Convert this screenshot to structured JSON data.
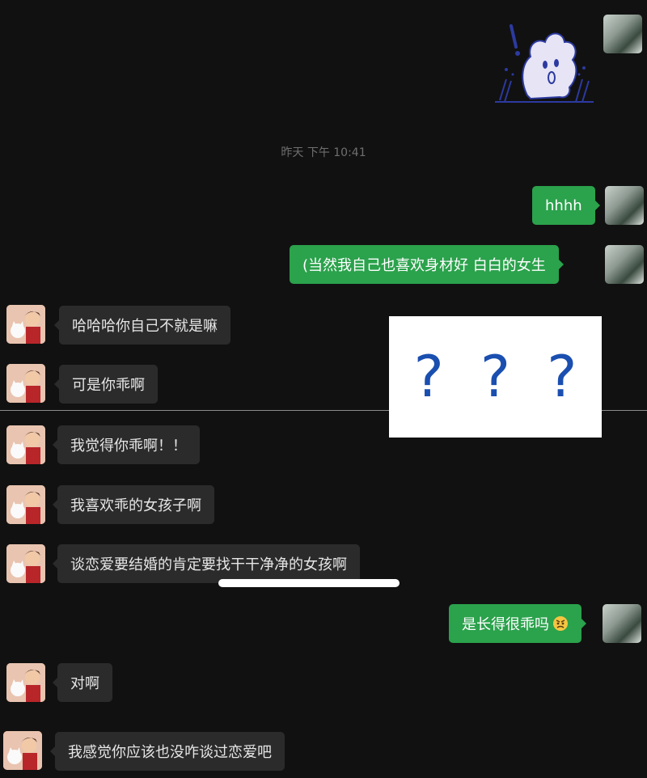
{
  "timestamp": "昨天 下午 10:41",
  "messages": {
    "m1": "hhhh",
    "m2": "(当然我自己也喜欢身材好 白白的女生",
    "m3": "哈哈哈你自己不就是嘛",
    "m4": "可是你乖啊",
    "m5": "我觉得你乖啊！！",
    "m6": "我喜欢乖的女孩子啊",
    "m7": "谈恋爱要结婚的肯定要找干干净净的女孩啊",
    "m8": "是长得很乖吗",
    "m9": "对啊",
    "m10": "我感觉你应该也没咋谈过恋爱吧"
  },
  "overlay": {
    "q1": "?",
    "q2": "?",
    "q3": "?"
  },
  "icons": {
    "sticker": "shocked-cartoon-sticker-icon",
    "emoji": "angry-face-emoji-icon",
    "self_avatar": "self-avatar-photo",
    "peer_avatar": "cartoon-boy-cat-avatar"
  },
  "colors": {
    "background": "#111111",
    "outgoing_bubble": "#2ba24c",
    "incoming_bubble": "#2b2b2b",
    "question_mark": "#1a4fb0"
  }
}
